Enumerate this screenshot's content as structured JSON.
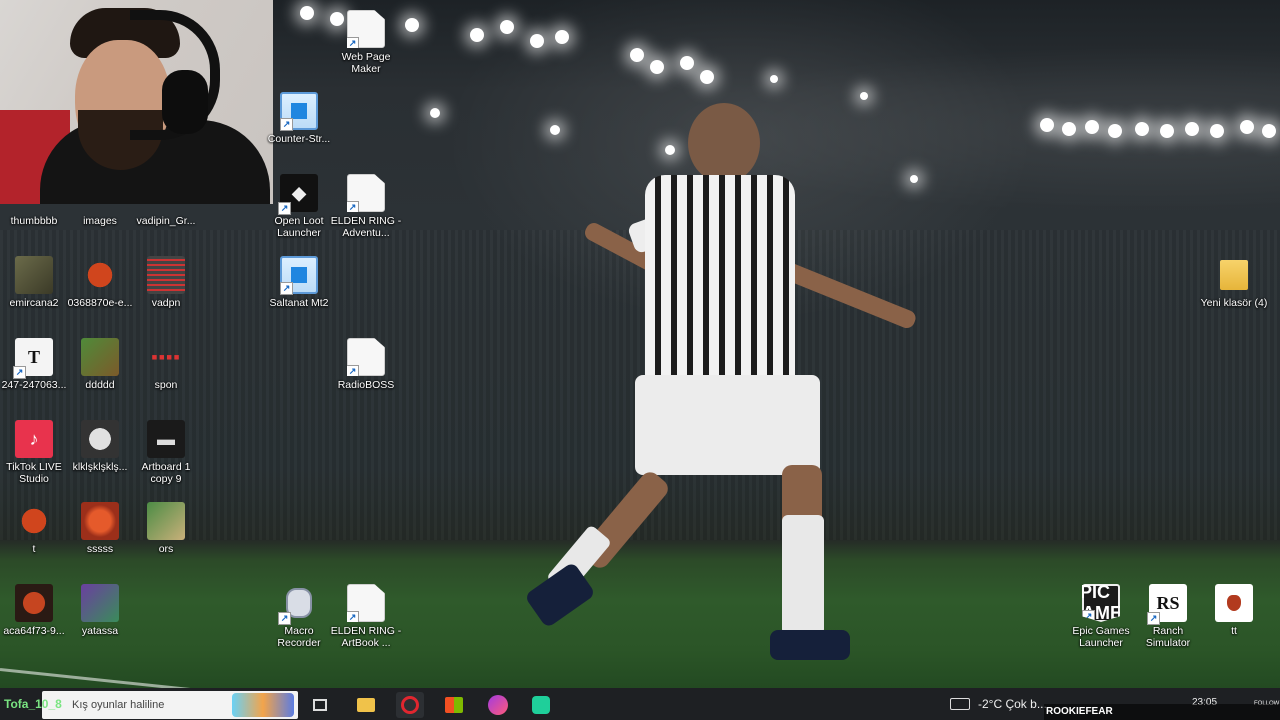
{
  "desktop": {
    "icons": [
      {
        "name": "web-page-maker",
        "label": "Web Page Maker",
        "glyph": "file"
      },
      {
        "name": "counter-strike",
        "label": "Counter-Str...",
        "glyph": "app-blue"
      },
      {
        "name": "open-loot-launcher",
        "label": "Open Loot Launcher",
        "glyph": "loot"
      },
      {
        "name": "elden-ring-adventure",
        "label": "ELDEN RING - Adventu...",
        "glyph": "file"
      },
      {
        "name": "thumbbbb",
        "label": "thumbbbb",
        "glyph": "none"
      },
      {
        "name": "images",
        "label": "images",
        "glyph": "none"
      },
      {
        "name": "vadipin-gr",
        "label": "vadipin_Gr...",
        "glyph": "none"
      },
      {
        "name": "emircana2",
        "label": "emircana2",
        "glyph": "img"
      },
      {
        "name": "0368870e",
        "label": "0368870e-e...",
        "glyph": "red"
      },
      {
        "name": "vadpn",
        "label": "vadpn",
        "glyph": "code"
      },
      {
        "name": "saltanat-mt2",
        "label": "Saltanat Mt2",
        "glyph": "app-blue"
      },
      {
        "name": "247-247063",
        "label": "247-247063...",
        "glyph": "t"
      },
      {
        "name": "ddddd",
        "label": "ddddd",
        "glyph": "green"
      },
      {
        "name": "spon",
        "label": "spon",
        "glyph": "dots"
      },
      {
        "name": "radioboss",
        "label": "RadioBOSS",
        "glyph": "file"
      },
      {
        "name": "tiktok-live-studio",
        "label": "TikTok LIVE Studio",
        "glyph": "tiktok"
      },
      {
        "name": "klklsklsklks",
        "label": "klklşklşklş...",
        "glyph": "avatar"
      },
      {
        "name": "artboard-1-copy-9",
        "label": "Artboard 1 copy 9",
        "glyph": "art"
      },
      {
        "name": "t",
        "label": "t",
        "glyph": "red"
      },
      {
        "name": "sssss",
        "label": "sssss",
        "glyph": "photo1"
      },
      {
        "name": "ors",
        "label": "ors",
        "glyph": "photo2"
      },
      {
        "name": "aca64f73",
        "label": "aca64f73-9...",
        "glyph": "logo"
      },
      {
        "name": "yatassa",
        "label": "yatassa",
        "glyph": "purple"
      },
      {
        "name": "macro-recorder",
        "label": "Macro Recorder",
        "glyph": "robot"
      },
      {
        "name": "elden-ring-artbook",
        "label": "ELDEN RING - ArtBook ...",
        "glyph": "file"
      },
      {
        "name": "yeni-klasor-4",
        "label": "Yeni klasör (4)",
        "glyph": "folder"
      },
      {
        "name": "epic-games-launcher",
        "label": "Epic Games Launcher",
        "glyph": "epic"
      },
      {
        "name": "ranch-simulator",
        "label": "Ranch Simulator",
        "glyph": "rs"
      },
      {
        "name": "tt",
        "label": "tt",
        "glyph": "tt"
      }
    ],
    "glyph_text": {
      "loot": "◆",
      "t": "T",
      "tiktok": "♪",
      "dots": "▪▪▪▪",
      "art": "▬",
      "epic": "EPIC GAMES",
      "rs": "RS"
    }
  },
  "taskbar": {
    "user_tag": "Tofa_10_8",
    "search_text": "Kış oyunlar haliline",
    "weather": "-2°C  Çok b...",
    "clock": "23:05",
    "watermark": "ROOKIEFEAR",
    "follow": "FOLLOW"
  }
}
